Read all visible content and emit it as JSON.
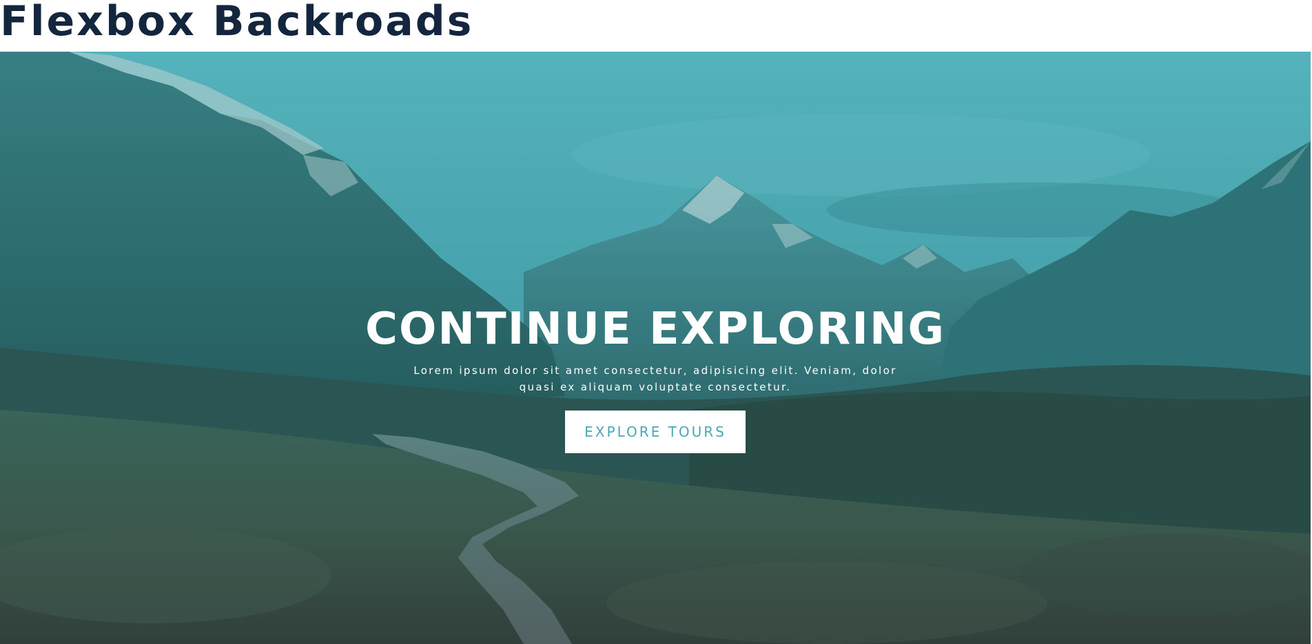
{
  "header": {
    "site_title": "Flexbox Backroads"
  },
  "hero": {
    "title": "CONTINUE EXPLORING",
    "text": "Lorem ipsum dolor sit amet consectetur, adipisicing elit. Veniam, dolor quasi ex aliquam voluptate consectetur.",
    "button_label": "EXPLORE TOURS",
    "background_image": "mountain-valley-boardwalk-photo"
  },
  "colors": {
    "title_color": "#13263e",
    "hero_overlay": "#4aa7b5",
    "button_text": "#4aa7b5",
    "button_background": "#ffffff"
  }
}
